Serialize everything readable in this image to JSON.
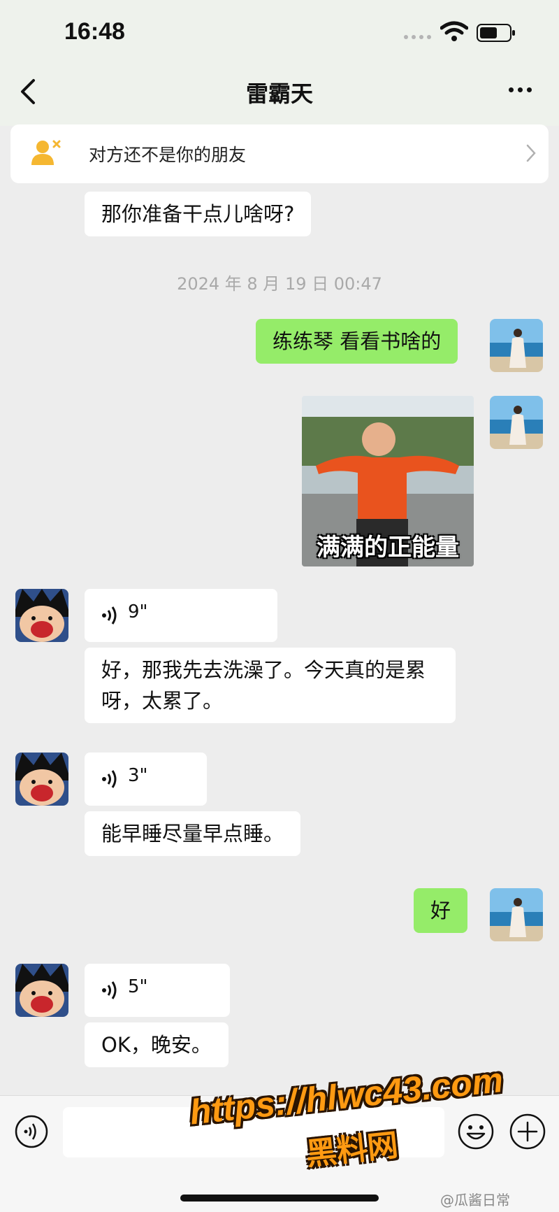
{
  "status_bar": {
    "time": "16:48"
  },
  "header": {
    "title": "雷霸天"
  },
  "friend_banner": {
    "text": "对方还不是你的朋友"
  },
  "messages": {
    "m1": "那你准备干点儿啥呀?",
    "timestamp": "2024 年 8 月 19 日 00:47",
    "m2": "练练琴 看看书啥的",
    "sticker_caption": "满满的正能量",
    "voice1": "9\"",
    "m3": "好，那我先去洗澡了。今天真的是累呀，太累了。",
    "voice2": "3\"",
    "m4": "能早睡尽量早点睡。",
    "m5": "好",
    "voice3": "5\"",
    "m6": "OK，晚安。"
  },
  "watermark": {
    "url": "https://hlwc43.com",
    "name": "黑料网"
  },
  "credit": "@瓜酱日常",
  "colors": {
    "bubble_green": "#95ec69",
    "background": "#ededed",
    "watermark": "#ff9a12"
  }
}
